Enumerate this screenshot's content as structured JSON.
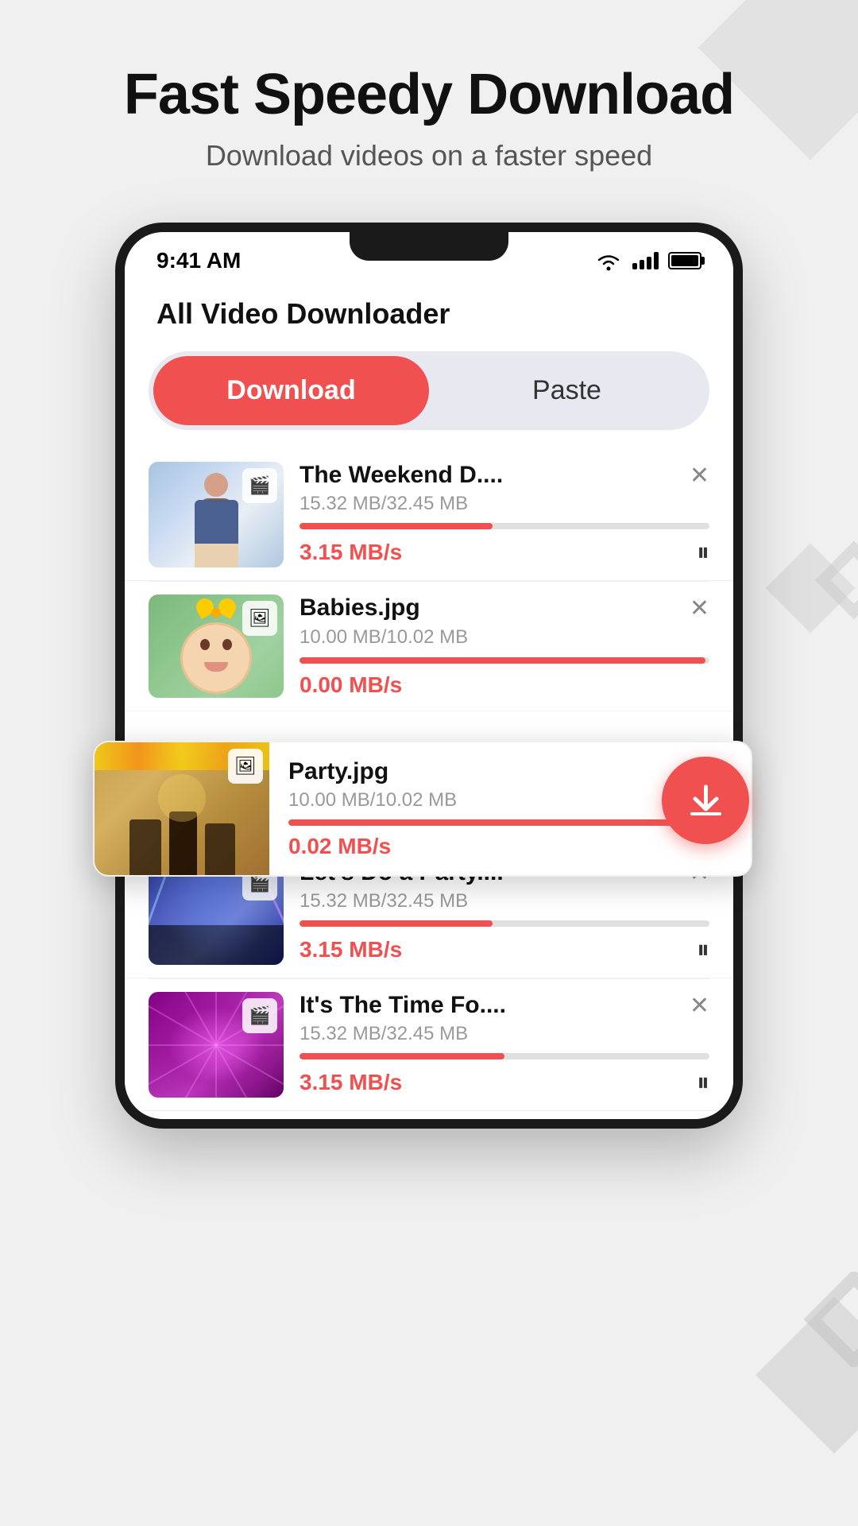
{
  "page": {
    "background_color": "#f0f0f0"
  },
  "header": {
    "title": "Fast Speedy Download",
    "subtitle": "Download videos on a faster speed"
  },
  "phone": {
    "status_bar": {
      "time": "9:41 AM"
    },
    "app_title": "All Video Downloader",
    "tabs": {
      "download_label": "Download",
      "paste_label": "Paste"
    },
    "downloads": [
      {
        "name": "The Weekend D....",
        "size": "15.32 MB/32.45 MB",
        "speed": "3.15 MB/s",
        "progress": 47,
        "type": "video",
        "thumb_class": "thumb-woman"
      },
      {
        "name": "Babies.jpg",
        "size": "10.00 MB/10.02 MB",
        "speed": "0.00 MB/s",
        "progress": 99,
        "type": "image",
        "thumb_class": "thumb-baby"
      },
      {
        "name": "Party.jpg",
        "size": "10.00 MB/10.02 MB",
        "speed": "0.02 MB/s",
        "progress": 99,
        "type": "image",
        "thumb_class": "thumb-party-indoor",
        "floating": true
      },
      {
        "name": "Let's Do a Party....",
        "size": "15.32 MB/32.45 MB",
        "speed": "3.15 MB/s",
        "progress": 47,
        "type": "video",
        "thumb_class": "thumb-party-concert"
      },
      {
        "name": "It's The Time Fo....",
        "size": "15.32 MB/32.45 MB",
        "speed": "3.15 MB/s",
        "progress": 50,
        "type": "video",
        "thumb_class": "thumb-lights"
      }
    ]
  }
}
